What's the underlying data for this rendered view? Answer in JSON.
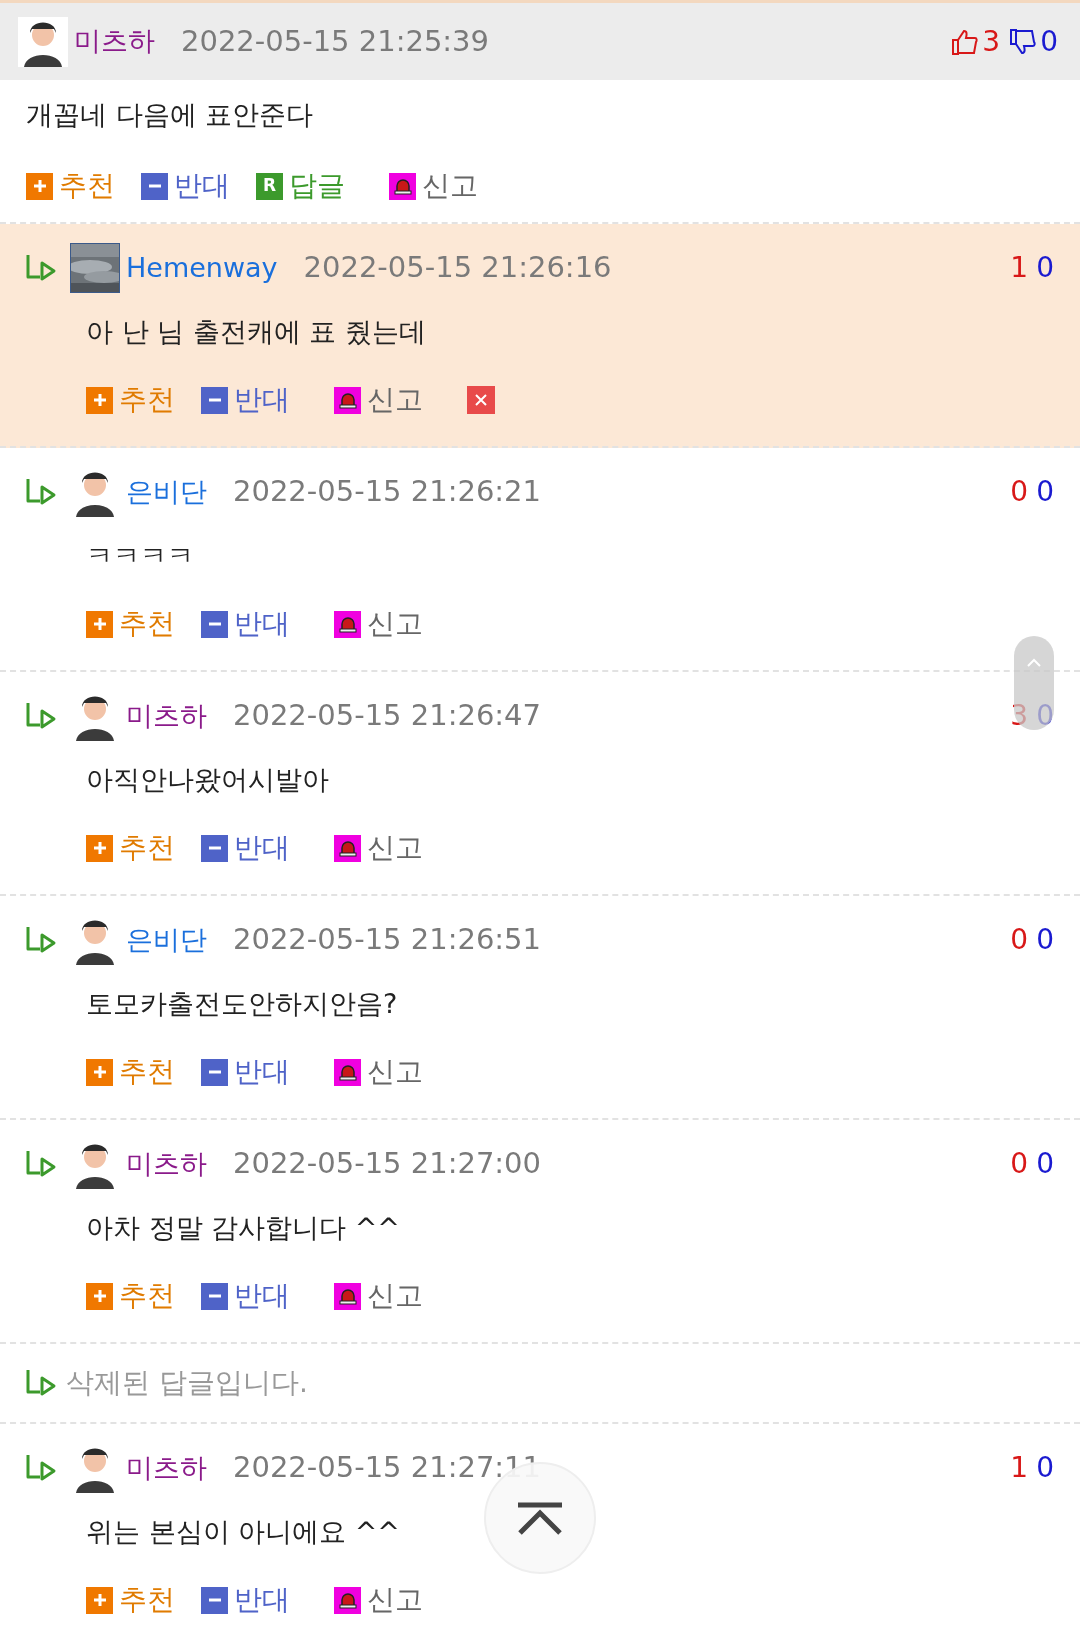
{
  "comments": [
    {
      "kind": "main",
      "highlighted": false,
      "deletable": false,
      "author": {
        "name": "미츠하",
        "color": "#8a1a8a",
        "avatar": {
          "kind": "figure"
        }
      },
      "time": "2022-05-15 21:25:39",
      "up": "3",
      "down": "0",
      "text": "개꼽네 다음에 표안준다",
      "actions": [
        {
          "kind": "recommend",
          "label": "추천"
        },
        {
          "kind": "oppose",
          "label": "반대"
        },
        {
          "kind": "reply",
          "label": "답글",
          "icon_text": "R"
        },
        {
          "kind": "report",
          "label": "신고"
        }
      ]
    },
    {
      "kind": "reply",
      "highlighted": true,
      "deletable": true,
      "author": {
        "name": "Hemenway",
        "color": "#1a6fdc"
      },
      "time": "2022-05-15 21:26:16",
      "up": "1",
      "down": "0",
      "text": "아 난 님 출전캐에 표 줬는데",
      "actions": [
        {
          "kind": "recommend",
          "label": "추천"
        },
        {
          "kind": "oppose",
          "label": "반대"
        },
        {
          "kind": "report",
          "label": "신고"
        }
      ]
    },
    {
      "kind": "reply",
      "highlighted": false,
      "deletable": false,
      "author": {
        "name": "은비단",
        "color": "#1a6fdc",
        "avatar": {
          "kind": "figure"
        }
      },
      "time": "2022-05-15 21:26:21",
      "up": "0",
      "down": "0",
      "text": "ㅋㅋㅋㅋ",
      "actions": [
        {
          "kind": "recommend",
          "label": "추천"
        },
        {
          "kind": "oppose",
          "label": "반대"
        },
        {
          "kind": "report",
          "label": "신고"
        }
      ]
    },
    {
      "kind": "reply",
      "highlighted": false,
      "deletable": false,
      "author": {
        "name": "미츠하",
        "color": "#8a1a8a",
        "avatar": {
          "kind": "figure"
        }
      },
      "time": "2022-05-15 21:26:47",
      "up": "3",
      "down": "0",
      "text": "아직안나왔어시발아",
      "actions": [
        {
          "kind": "recommend",
          "label": "추천"
        },
        {
          "kind": "oppose",
          "label": "반대"
        },
        {
          "kind": "report",
          "label": "신고"
        }
      ]
    },
    {
      "kind": "reply",
      "highlighted": false,
      "deletable": false,
      "author": {
        "name": "은비단",
        "color": "#1a6fdc",
        "avatar": {
          "kind": "figure"
        }
      },
      "time": "2022-05-15 21:26:51",
      "up": "0",
      "down": "0",
      "text": "토모카출전도안하지안음?",
      "actions": [
        {
          "kind": "recommend",
          "label": "추천"
        },
        {
          "kind": "oppose",
          "label": "반대"
        },
        {
          "kind": "report",
          "label": "신고"
        }
      ]
    },
    {
      "kind": "reply",
      "highlighted": false,
      "deletable": false,
      "author": {
        "name": "미츠하",
        "color": "#8a1a8a",
        "avatar": {
          "kind": "figure"
        }
      },
      "time": "2022-05-15 21:27:00",
      "up": "0",
      "down": "0",
      "text": "아차 정말 감사합니다 ^^",
      "actions": [
        {
          "kind": "recommend",
          "label": "추천"
        },
        {
          "kind": "oppose",
          "label": "반대"
        },
        {
          "kind": "report",
          "label": "신고"
        }
      ]
    },
    {
      "kind": "deleted",
      "text": "삭제된 답글입니다."
    },
    {
      "kind": "reply",
      "highlighted": false,
      "deletable": false,
      "author": {
        "name": "미츠하",
        "color": "#8a1a8a",
        "avatar": {
          "kind": "figure"
        }
      },
      "time": "2022-05-15 21:27:11",
      "up": "1",
      "down": "0",
      "text": "위는 본심이 아니에요 ^^",
      "actions": [
        {
          "kind": "recommend",
          "label": "추천"
        },
        {
          "kind": "oppose",
          "label": "반대"
        },
        {
          "kind": "report",
          "label": "신고"
        }
      ]
    }
  ]
}
